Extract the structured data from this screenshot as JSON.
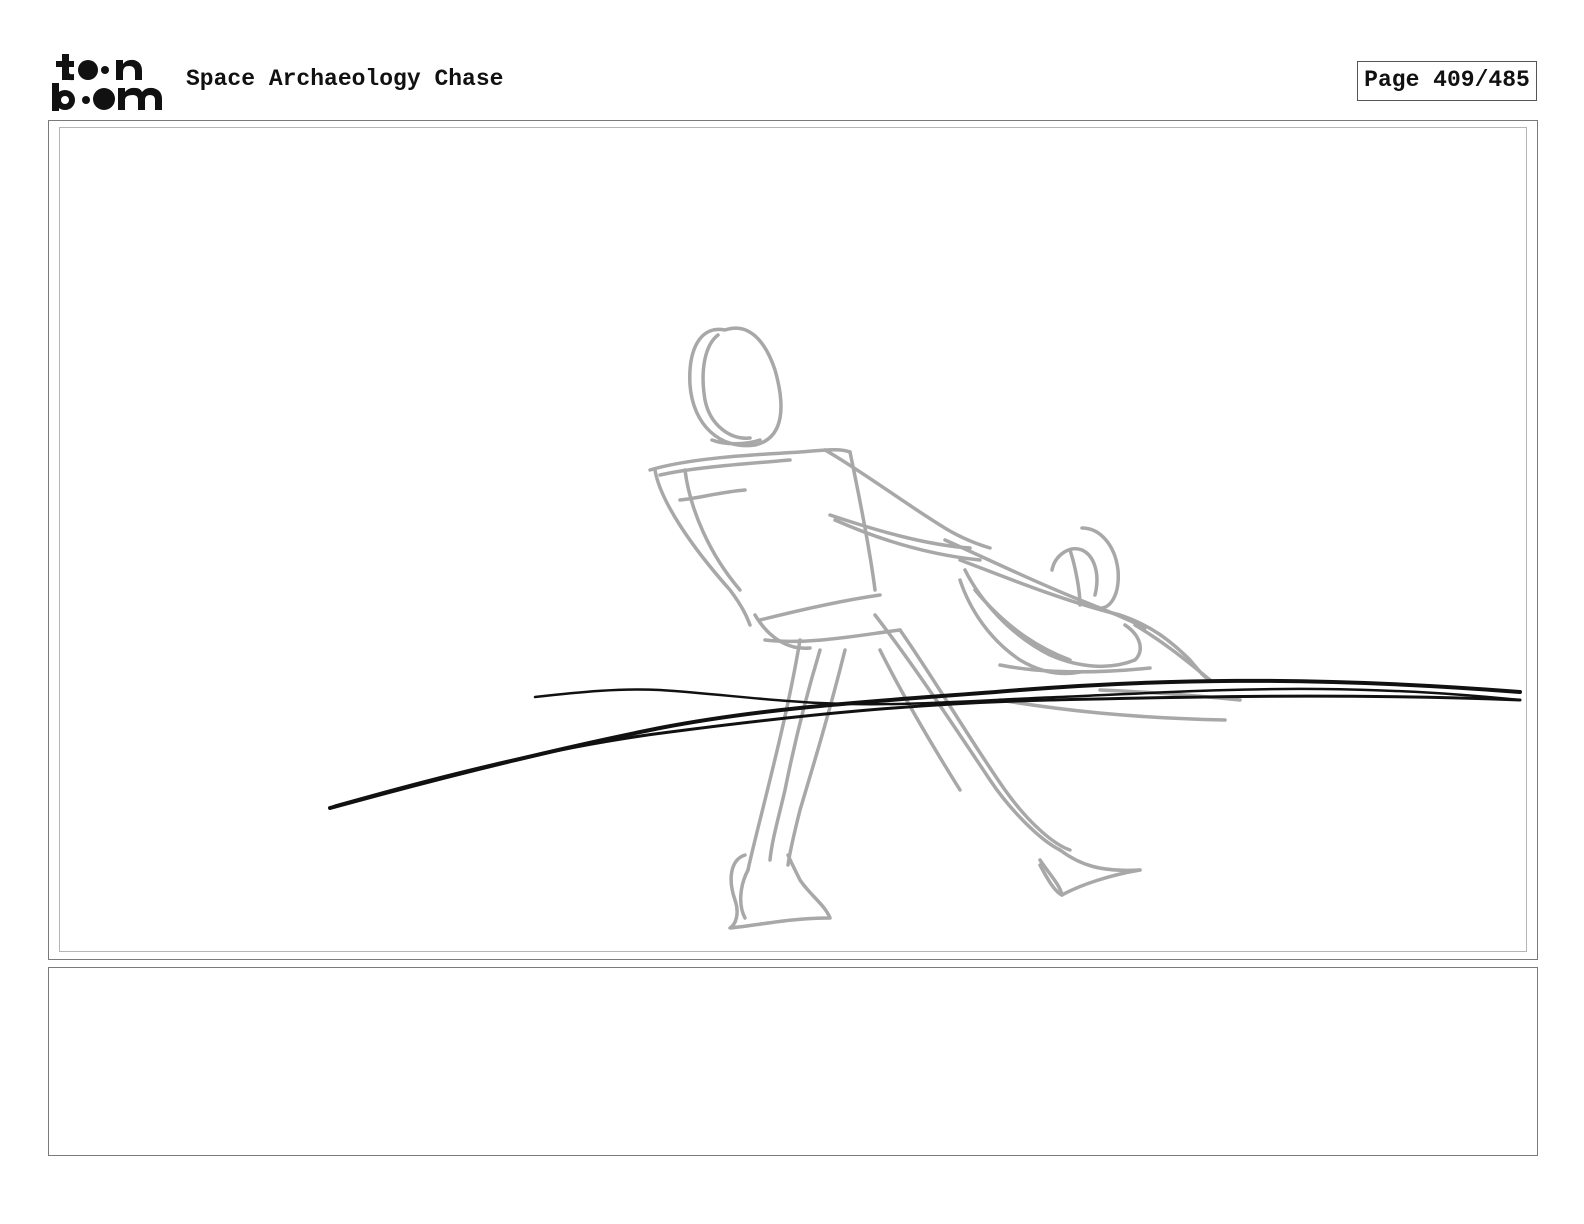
{
  "header": {
    "logo": {
      "wordmark": "toon boom",
      "color": "#111111"
    },
    "project_title": "Space Archaeology Chase",
    "page_indicator": "Page 409/485"
  },
  "panel": {
    "sketch_color_rough": "#a8a8a8",
    "sketch_color_ink": "#111111"
  },
  "caption": {
    "text": ""
  }
}
